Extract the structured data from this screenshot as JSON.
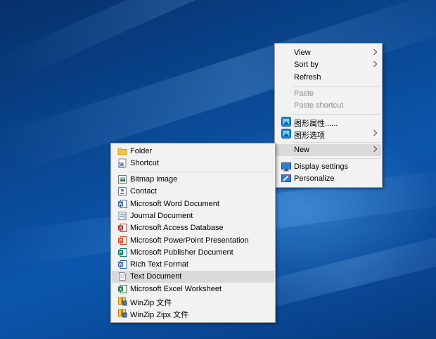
{
  "desktop_menu": {
    "items": [
      {
        "label": "View",
        "has_submenu": true,
        "enabled": true
      },
      {
        "label": "Sort by",
        "has_submenu": true,
        "enabled": true
      },
      {
        "label": "Refresh",
        "enabled": true
      },
      {
        "label": "Paste",
        "enabled": false
      },
      {
        "label": "Paste shortcut",
        "enabled": false
      },
      {
        "label": "图形属性......",
        "icon": "graphics-icon",
        "enabled": true
      },
      {
        "label": "图形选项",
        "icon": "graphics-icon",
        "has_submenu": true,
        "enabled": true
      },
      {
        "label": "New",
        "has_submenu": true,
        "enabled": true,
        "highlighted": true
      },
      {
        "label": "Display settings",
        "icon": "monitor-icon",
        "enabled": true
      },
      {
        "label": "Personalize",
        "icon": "personalize-icon",
        "enabled": true
      }
    ]
  },
  "new_submenu": {
    "items": [
      {
        "label": "Folder",
        "icon": "folder-icon"
      },
      {
        "label": "Shortcut",
        "icon": "shortcut-icon"
      },
      {
        "label": "Bitmap image",
        "icon": "bitmap-icon"
      },
      {
        "label": "Contact",
        "icon": "contact-icon"
      },
      {
        "label": "Microsoft Word Document",
        "icon": "word-icon"
      },
      {
        "label": "Journal Document",
        "icon": "journal-icon"
      },
      {
        "label": "Microsoft Access Database",
        "icon": "access-icon"
      },
      {
        "label": "Microsoft PowerPoint Presentation",
        "icon": "powerpoint-icon"
      },
      {
        "label": "Microsoft Publisher Document",
        "icon": "publisher-icon"
      },
      {
        "label": "Rich Text Format",
        "icon": "rtf-icon"
      },
      {
        "label": "Text Document",
        "icon": "text-document-icon",
        "highlighted": true
      },
      {
        "label": "Microsoft Excel Worksheet",
        "icon": "excel-icon"
      },
      {
        "label": "WinZip 文件",
        "icon": "winzip-icon"
      },
      {
        "label": "WinZip Zipx 文件",
        "icon": "winzip-icon"
      }
    ]
  },
  "colors": {
    "word": "#2b579a",
    "access": "#a4373a",
    "powerpoint": "#d24726",
    "publisher": "#077568",
    "excel": "#217346",
    "graphics": "#1f8ad6",
    "folder": "#f4c542",
    "winzip": "#e0a800"
  }
}
